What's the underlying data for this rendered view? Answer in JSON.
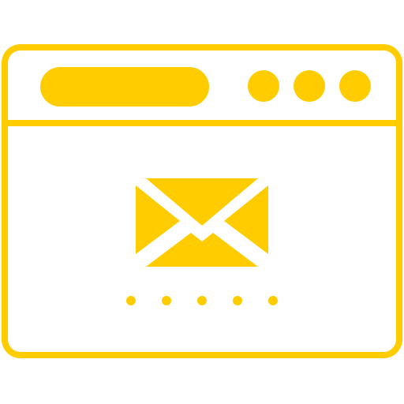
{
  "icon": {
    "name": "browser-email-icon",
    "color": "#FFCC00",
    "background": "#FFFFFF"
  },
  "window": {
    "address_bar": {
      "name": "address-bar-pill"
    },
    "controls": [
      "window-control-dot",
      "window-control-dot",
      "window-control-dot"
    ]
  },
  "content": {
    "center_icon": "envelope-icon",
    "pagination_dots": 5
  }
}
